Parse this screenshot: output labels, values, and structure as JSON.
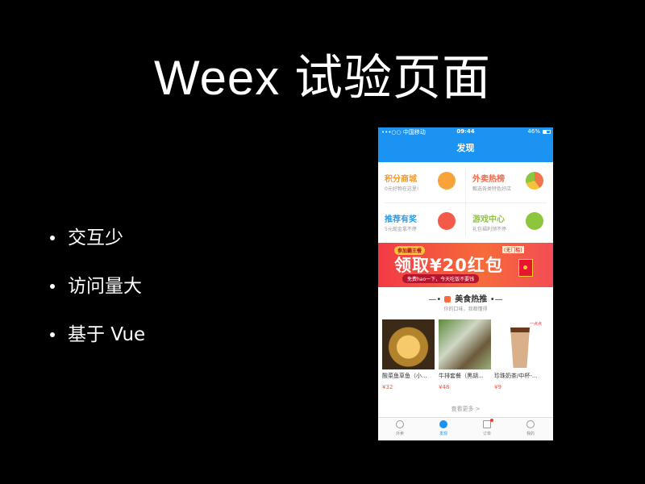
{
  "slide": {
    "title": "Weex 试验页面",
    "bullets": [
      "交互少",
      "访问量大",
      "基于 Vue"
    ]
  },
  "phone": {
    "status": {
      "carrier": "•••○○ 中国移动",
      "time": "09:44",
      "battery": "46%"
    },
    "nav_title": "发现",
    "grid": [
      {
        "title": "积分商城",
        "subtitle": "0元好物在这里!",
        "color": "#f29a2a",
        "icon": "gift-icon",
        "icon_color": "#f7a23a"
      },
      {
        "title": "外卖热榜",
        "subtitle": "甄选各类特色好店",
        "color": "#f26a4a",
        "icon": "pie-chart-icon",
        "icon_color": "#f0744c"
      },
      {
        "title": "推荐有奖",
        "subtitle": "5元现金拿不停",
        "color": "#2a9ce6",
        "icon": "present-icon",
        "icon_color": "#f35a4a"
      },
      {
        "title": "游戏中心",
        "subtitle": "礼包福利领不停",
        "color": "#8cc63e",
        "icon": "game-icon",
        "icon_color": "#8cc63e"
      }
    ],
    "banner": {
      "tag": "参加霸王餐",
      "tag2": "(无门槛)",
      "main": "领取¥20红包",
      "sub": "免费hao一下，今天吃饭不要钱"
    },
    "section": {
      "title": "美食热推",
      "subtitle": "你的口味，我都懂得"
    },
    "foods": [
      {
        "name": "酸菜鱼草鱼（小...",
        "price": "¥32"
      },
      {
        "name": "牛排套餐（黑胡...",
        "price": "¥48"
      },
      {
        "name": "珍珠奶茶/中杯-...",
        "price": "¥9"
      }
    ],
    "cup_brand": "一点点",
    "see_more": "查看更多 >",
    "tabs": [
      {
        "label": "外卖",
        "icon": "takeout-icon"
      },
      {
        "label": "发现",
        "icon": "compass-icon"
      },
      {
        "label": "订单",
        "icon": "order-icon"
      },
      {
        "label": "我的",
        "icon": "profile-icon"
      }
    ]
  }
}
